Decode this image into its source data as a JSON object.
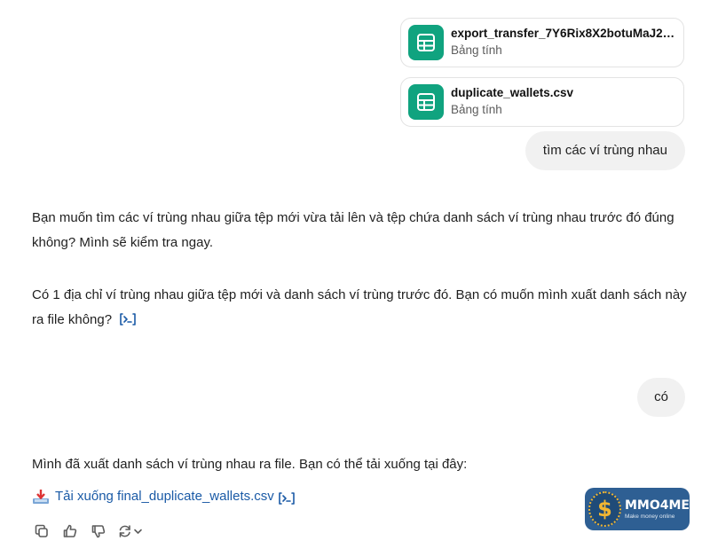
{
  "attachments": [
    {
      "name": "export_transfer_7Y6Rix8X2botuMaJ2m...",
      "type": "Bảng tính",
      "icon": "spreadsheet-icon"
    },
    {
      "name": "duplicate_wallets.csv",
      "type": "Bảng tính",
      "icon": "spreadsheet-icon"
    }
  ],
  "messages": {
    "user_1": "tìm các ví trùng nhau",
    "assistant_1_p1": "Bạn muốn tìm các ví trùng nhau giữa tệp mới vừa tải lên và tệp chứa danh sách ví trùng nhau trước đó đúng không? Mình sẽ kiểm tra ngay.",
    "assistant_1_p2": "Có 1 địa chỉ ví trùng nhau giữa tệp mới và danh sách ví trùng trước đó. Bạn có muốn mình xuất danh sách này ra file không?",
    "user_2": "có",
    "assistant_2_p1": "Mình đã xuất danh sách ví trùng nhau ra file. Bạn có thể tải xuống tại đây:",
    "download_link": "Tải xuống final_duplicate_wallets.csv"
  },
  "actions": [
    "copy-icon",
    "thumbs-up-icon",
    "thumbs-down-icon",
    "regenerate-icon",
    "chevron-down-icon"
  ],
  "watermark": {
    "title": "MMO4ME",
    "subtitle": "Make money online",
    "symbol": "$"
  },
  "colors": {
    "spreadsheet_icon_bg": "#10a37f",
    "link": "#1a5aa6",
    "user_bubble": "#f1f1f1",
    "watermark_bg": "#2e5f93"
  }
}
